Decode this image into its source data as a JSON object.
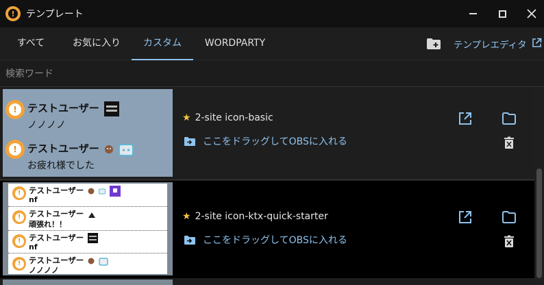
{
  "window": {
    "title": "テンプレート"
  },
  "tabs": [
    {
      "label": "すべて"
    },
    {
      "label": "お気に入り"
    },
    {
      "label": "カスタム",
      "active": true
    },
    {
      "label": "WORDPARTY"
    }
  ],
  "toolbar": {
    "editor_label": "テンプレエディタ"
  },
  "search": {
    "placeholder": "検索ワード",
    "value": ""
  },
  "colors": {
    "accent": "#8fc3ef",
    "star": "#f5c542",
    "brand_orange": "#f2a33a"
  },
  "templates": [
    {
      "name": "2-site icon-basic",
      "drag_label": "ここをドラッグしてOBSに入れる",
      "favorite": true,
      "preview": [
        {
          "user": "テストユーザー",
          "message": "ノノノノ"
        },
        {
          "user": "テストユーザー",
          "message": "お疲れ様でした"
        }
      ]
    },
    {
      "name": "2-site icon-ktx-quick-starter",
      "drag_label": "ここをドラッグしてOBSに入れる",
      "favorite": true,
      "preview": [
        {
          "user": "テストユーザー",
          "message": "nf"
        },
        {
          "user": "テストユーザー",
          "message": "頑張れ！！"
        },
        {
          "user": "テストユーザー",
          "message": "nf"
        },
        {
          "user": "テストユーザー",
          "message": "ノノノノ"
        }
      ]
    }
  ]
}
